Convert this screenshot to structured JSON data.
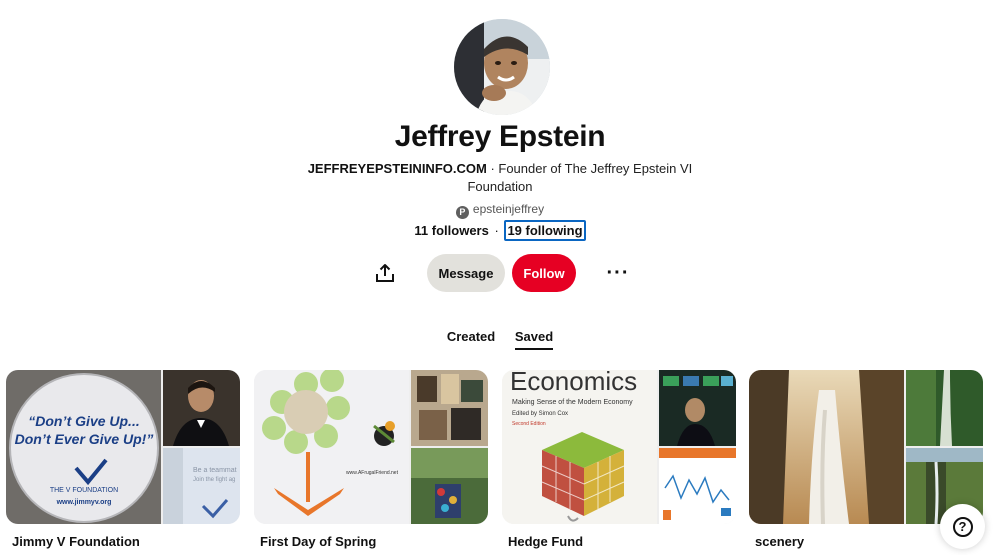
{
  "profile": {
    "name": "Jeffrey Epstein",
    "bio_site": "JEFFREYEPSTEININFO.COM",
    "bio_text": " · Founder of The Jeffrey Epstein VI Foundation",
    "handle_icon": "P",
    "handle": "epsteinjeffrey",
    "followers": "11 followers",
    "separator": "·",
    "following": "19 following"
  },
  "actions": {
    "share_icon": "share-icon",
    "message_label": "Message",
    "follow_label": "Follow",
    "more_label": "···"
  },
  "tabs": {
    "created": "Created",
    "saved": "Saved"
  },
  "boards": [
    {
      "title": "Jimmy V Foundation",
      "button_line1": "“Don’t Give Up...",
      "button_line2": "Don’t Ever Give Up!”",
      "logo": "THE V FOUNDATION",
      "url": "www.jimmyv.org",
      "side_text1": "Be a teammat",
      "side_text2": "Join the fight ag"
    },
    {
      "title": "First Day of Spring",
      "caption": "www.AFrugalFriend.net"
    },
    {
      "title": "Hedge Fund",
      "book_title": "Economics",
      "book_subtitle": "Making Sense of the Modern Economy",
      "book_editor": "Edited by Simon Cox",
      "book_edition": "Second Edition"
    },
    {
      "title": "scenery"
    }
  ],
  "help": {
    "label": "?"
  },
  "colors": {
    "follow": "#e60023",
    "message": "#e2e1dc",
    "focus_ring": "#0a66c2"
  }
}
